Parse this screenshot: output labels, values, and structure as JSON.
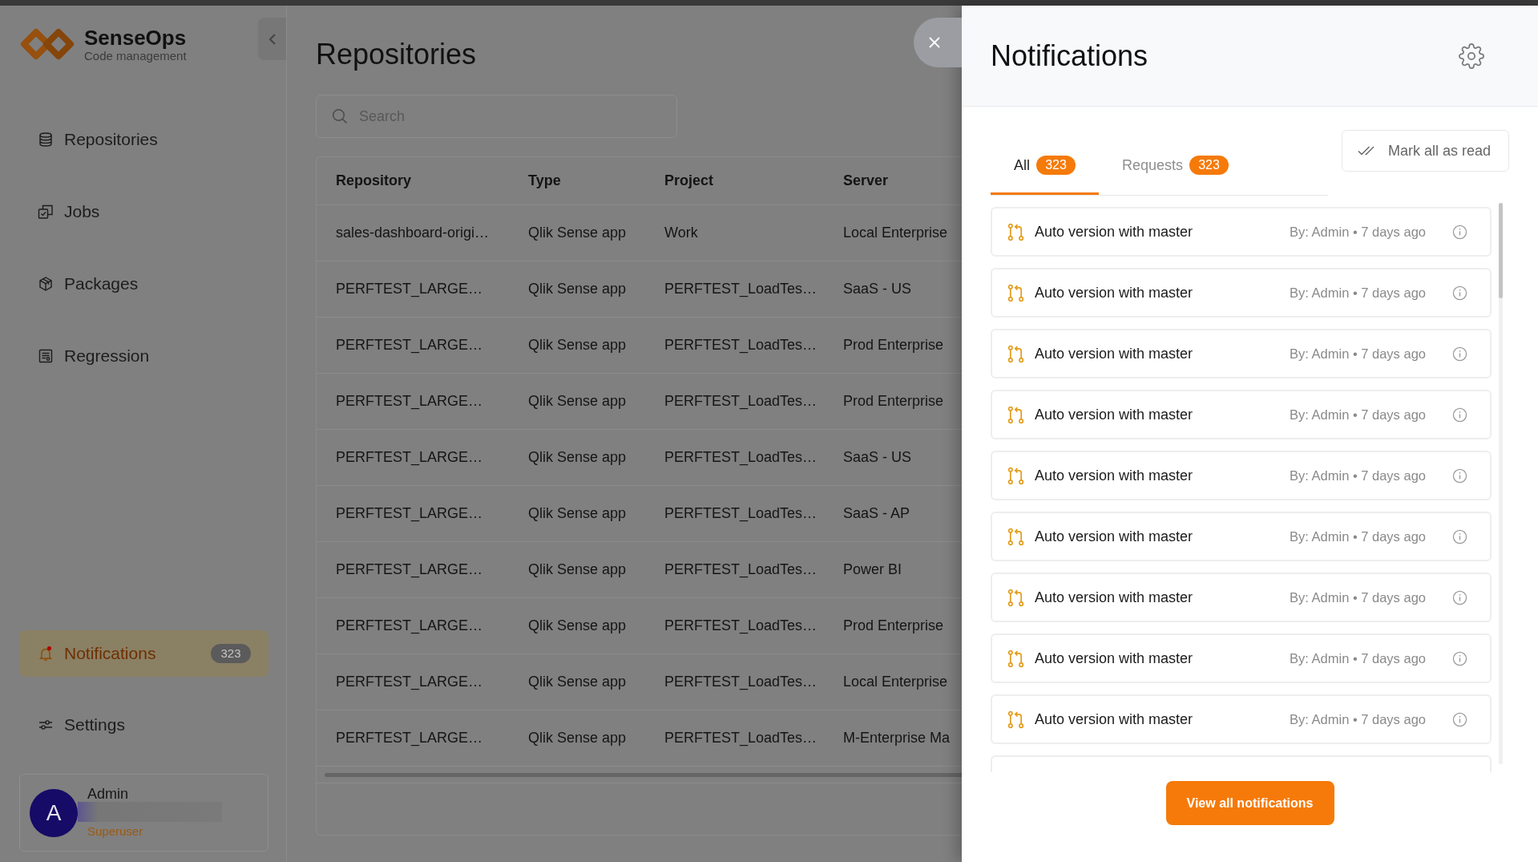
{
  "app": {
    "name": "SenseOps",
    "subtitle": "Code management"
  },
  "sidebar": {
    "main_items": [
      {
        "label": "Repositories",
        "selected": false
      },
      {
        "label": "Jobs",
        "selected": false
      },
      {
        "label": "Packages",
        "selected": false
      },
      {
        "label": "Regression",
        "selected": false
      }
    ],
    "bottom_items": [
      {
        "label": "Notifications",
        "selected": true,
        "badge": "323"
      },
      {
        "label": "Settings",
        "selected": false
      }
    ]
  },
  "user": {
    "initial": "A",
    "name": "Admin",
    "role": "Superuser"
  },
  "page": {
    "title": "Repositories",
    "search": {
      "placeholder": "Search"
    }
  },
  "table": {
    "columns": [
      "Repository",
      "Type",
      "Project",
      "Server"
    ],
    "rows": [
      [
        "sales-dashboard-origi…",
        "Qlik Sense app",
        "Work",
        "Local Enterprise"
      ],
      [
        "PERFTEST_LARGE…",
        "Qlik Sense app",
        "PERFTEST_LoadTes…",
        "SaaS - US"
      ],
      [
        "PERFTEST_LARGE…",
        "Qlik Sense app",
        "PERFTEST_LoadTes…",
        "Prod Enterprise"
      ],
      [
        "PERFTEST_LARGE…",
        "Qlik Sense app",
        "PERFTEST_LoadTes…",
        "Prod Enterprise"
      ],
      [
        "PERFTEST_LARGE…",
        "Qlik Sense app",
        "PERFTEST_LoadTes…",
        "SaaS - US"
      ],
      [
        "PERFTEST_LARGE…",
        "Qlik Sense app",
        "PERFTEST_LoadTes…",
        "SaaS - AP"
      ],
      [
        "PERFTEST_LARGE…",
        "Qlik Sense app",
        "PERFTEST_LoadTes…",
        "Power BI"
      ],
      [
        "PERFTEST_LARGE…",
        "Qlik Sense app",
        "PERFTEST_LoadTes…",
        "Prod Enterprise"
      ],
      [
        "PERFTEST_LARGE…",
        "Qlik Sense app",
        "PERFTEST_LoadTes…",
        "Local Enterprise"
      ],
      [
        "PERFTEST_LARGE…",
        "Qlik Sense app",
        "PERFTEST_LoadTes…",
        "M-Enterprise Ma"
      ]
    ]
  },
  "notifications_panel": {
    "title": "Notifications",
    "tabs": [
      {
        "label": "All",
        "count": "323",
        "selected": true
      },
      {
        "label": "Requests",
        "count": "323",
        "selected": false
      }
    ],
    "mark_all_button": "Mark all as read",
    "items": [
      {
        "title": "Auto version with master",
        "meta": "By: Admin • 7 days ago"
      },
      {
        "title": "Auto version with master",
        "meta": "By: Admin • 7 days ago"
      },
      {
        "title": "Auto version with master",
        "meta": "By: Admin • 7 days ago"
      },
      {
        "title": "Auto version with master",
        "meta": "By: Admin • 7 days ago"
      },
      {
        "title": "Auto version with master",
        "meta": "By: Admin • 7 days ago"
      },
      {
        "title": "Auto version with master",
        "meta": "By: Admin • 7 days ago"
      },
      {
        "title": "Auto version with master",
        "meta": "By: Admin • 7 days ago"
      },
      {
        "title": "Auto version with master",
        "meta": "By: Admin • 7 days ago"
      },
      {
        "title": "Auto version with master",
        "meta": "By: Admin • 7 days ago"
      }
    ],
    "more_items_below": true,
    "view_all_button": "View all notifications"
  }
}
